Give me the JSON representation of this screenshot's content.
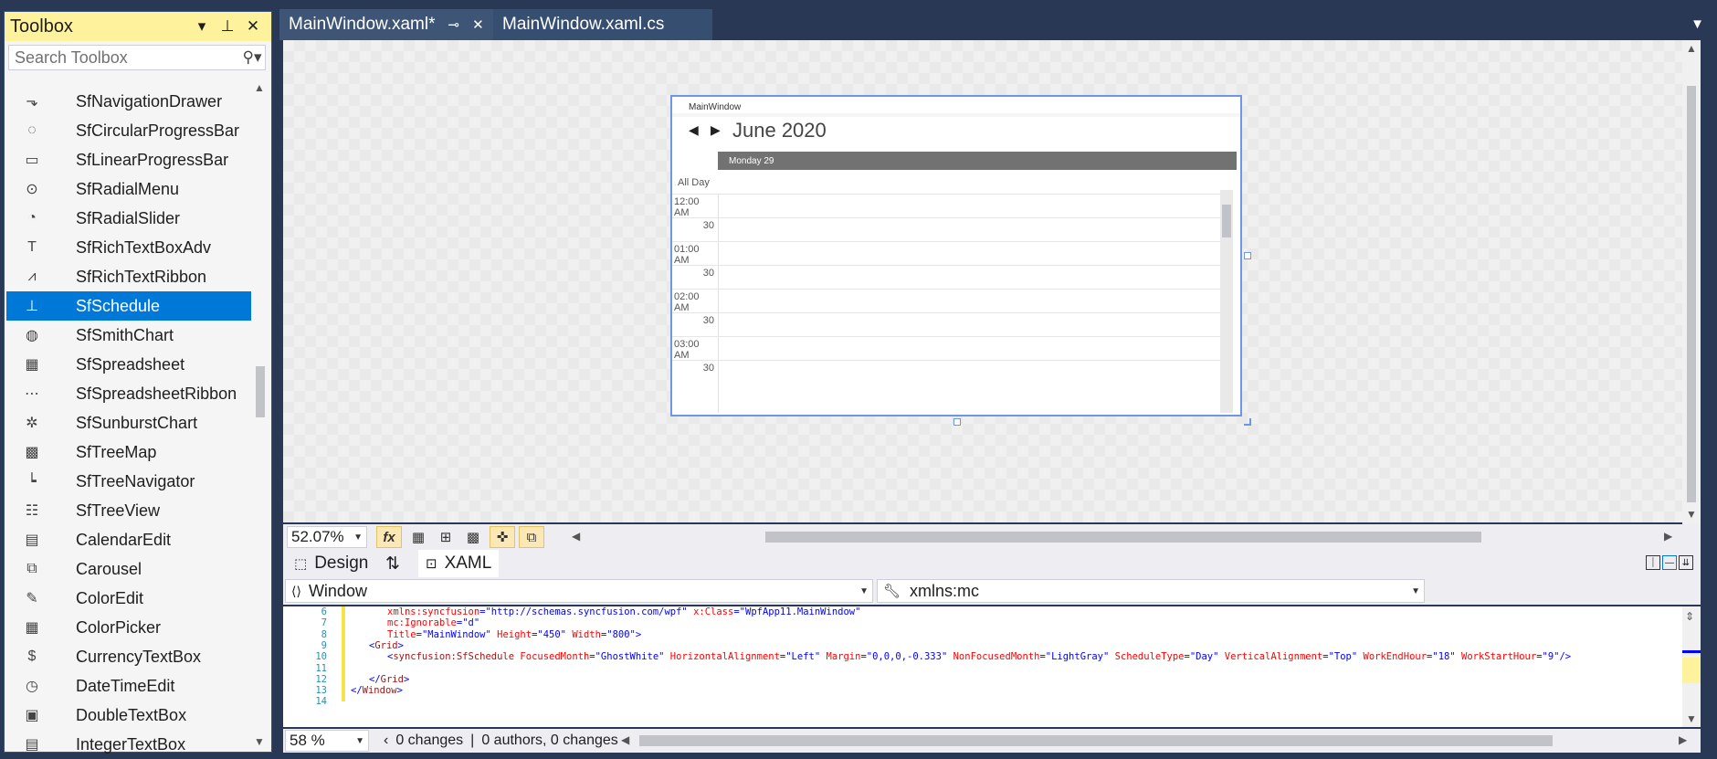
{
  "toolbox": {
    "title": "Toolbox",
    "search_placeholder": "Search Toolbox",
    "items": [
      {
        "label": "SfNavigationDrawer",
        "icon": "navigation-drawer-icon",
        "glyph": "⬎",
        "selected": false
      },
      {
        "label": "SfCircularProgressBar",
        "icon": "circular-progress-icon",
        "glyph": "◌",
        "selected": false
      },
      {
        "label": "SfLinearProgressBar",
        "icon": "linear-progress-icon",
        "glyph": "▭",
        "selected": false
      },
      {
        "label": "SfRadialMenu",
        "icon": "radial-menu-icon",
        "glyph": "⊙",
        "selected": false
      },
      {
        "label": "SfRadialSlider",
        "icon": "radial-slider-icon",
        "glyph": "◔",
        "selected": false
      },
      {
        "label": "SfRichTextBoxAdv",
        "icon": "rich-textbox-icon",
        "glyph": "T",
        "selected": false
      },
      {
        "label": "SfRichTextRibbon",
        "icon": "rich-text-ribbon-icon",
        "glyph": "⩘",
        "selected": false
      },
      {
        "label": "SfSchedule",
        "icon": "schedule-icon",
        "glyph": "⊥",
        "selected": true
      },
      {
        "label": "SfSmithChart",
        "icon": "smith-chart-icon",
        "glyph": "◍",
        "selected": false
      },
      {
        "label": "SfSpreadsheet",
        "icon": "spreadsheet-icon",
        "glyph": "▦",
        "selected": false
      },
      {
        "label": "SfSpreadsheetRibbon",
        "icon": "spreadsheet-ribbon-icon",
        "glyph": "⋯",
        "selected": false
      },
      {
        "label": "SfSunburstChart",
        "icon": "sunburst-chart-icon",
        "glyph": "✲",
        "selected": false
      },
      {
        "label": "SfTreeMap",
        "icon": "treemap-icon",
        "glyph": "▩",
        "selected": false
      },
      {
        "label": "SfTreeNavigator",
        "icon": "tree-navigator-icon",
        "glyph": "┕",
        "selected": false
      },
      {
        "label": "SfTreeView",
        "icon": "treeview-icon",
        "glyph": "☷",
        "selected": false
      },
      {
        "label": "CalendarEdit",
        "icon": "calendar-edit-icon",
        "glyph": "▤",
        "selected": false
      },
      {
        "label": "Carousel",
        "icon": "carousel-icon",
        "glyph": "⧉",
        "selected": false
      },
      {
        "label": "ColorEdit",
        "icon": "color-edit-icon",
        "glyph": "✎",
        "selected": false
      },
      {
        "label": "ColorPicker",
        "icon": "color-picker-icon",
        "glyph": "▦",
        "selected": false
      },
      {
        "label": "CurrencyTextBox",
        "icon": "currency-textbox-icon",
        "glyph": "$",
        "selected": false
      },
      {
        "label": "DateTimeEdit",
        "icon": "datetime-edit-icon",
        "glyph": "◷",
        "selected": false
      },
      {
        "label": "DoubleTextBox",
        "icon": "double-textbox-icon",
        "glyph": "▣",
        "selected": false
      },
      {
        "label": "IntegerTextBox",
        "icon": "integer-textbox-icon",
        "glyph": "▤",
        "selected": false
      }
    ]
  },
  "tabs": {
    "active": "MainWindow.xaml*",
    "inactive": "MainWindow.xaml.cs"
  },
  "preview": {
    "window_title": "MainWindow",
    "month": "June 2020",
    "day_header": "Monday 29",
    "all_day": "All Day",
    "time_slots": [
      {
        "hour": "12:00 AM",
        "half": "30"
      },
      {
        "hour": "01:00 AM",
        "half": "30"
      },
      {
        "hour": "02:00 AM",
        "half": "30"
      },
      {
        "hour": "03:00 AM",
        "half": "30"
      }
    ]
  },
  "designer_toolbar": {
    "zoom": "52.07%"
  },
  "split": {
    "design": "Design",
    "swap": "⇅",
    "xaml": "XAML"
  },
  "combos": {
    "element": "Window",
    "member": "xmlns:mc"
  },
  "code": {
    "lines": [
      {
        "num": "6",
        "html": "<span class=\"c-attr\">xmlns:syncfusion</span><span class=\"c-punc\">=</span><span class=\"c-val\">\"http://schemas.syncfusion.com/wpf\"</span> <span class=\"c-attr\">x:Class</span><span class=\"c-punc\">=</span><span class=\"c-val\">\"WpfApp11.MainWindow\"</span>",
        "indent": 2
      },
      {
        "num": "7",
        "html": "<span class=\"c-attr\">mc:Ignorable</span><span class=\"c-punc\">=</span><span class=\"c-val\">\"d\"</span>",
        "indent": 2
      },
      {
        "num": "8",
        "html": "<span class=\"c-attr\">Title</span><span class=\"c-punc\">=</span><span class=\"c-val\">\"MainWindow\"</span> <span class=\"c-attr\">Height</span><span class=\"c-punc\">=</span><span class=\"c-val\">\"450\"</span> <span class=\"c-attr\">Width</span><span class=\"c-punc\">=</span><span class=\"c-val\">\"800\"</span><span class=\"c-punc\">&gt;</span>",
        "indent": 2
      },
      {
        "num": "9",
        "html": "<span class=\"c-punc\">&lt;</span><span class=\"c-tag\">Grid</span><span class=\"c-punc\">&gt;</span>",
        "indent": 1
      },
      {
        "num": "10",
        "html": "<span class=\"c-punc\">&lt;</span><span class=\"c-tag\">syncfusion:SfSchedule</span> <span class=\"c-attr\">FocusedMonth</span><span class=\"c-punc\">=</span><span class=\"c-val\">\"GhostWhite\"</span> <span class=\"c-attr\">HorizontalAlignment</span><span class=\"c-punc\">=</span><span class=\"c-val\">\"Left\"</span> <span class=\"c-attr\">Margin</span><span class=\"c-punc\">=</span><span class=\"c-val\">\"0,0,0,-0.333\"</span> <span class=\"c-attr\">NonFocusedMonth</span><span class=\"c-punc\">=</span><span class=\"c-val\">\"LightGray\"</span> <span class=\"c-attr\">ScheduleType</span><span class=\"c-punc\">=</span><span class=\"c-val\">\"Day\"</span> <span class=\"c-attr\">VerticalAlignment</span><span class=\"c-punc\">=</span><span class=\"c-val\">\"Top\"</span> <span class=\"c-attr\">WorkEndHour</span><span class=\"c-punc\">=</span><span class=\"c-val\">\"18\"</span> <span class=\"c-attr\">WorkStartHour</span><span class=\"c-punc\">=</span><span class=\"c-val\">\"9\"</span><span class=\"c-punc\">/&gt;</span>",
        "indent": 2
      },
      {
        "num": "11",
        "html": "",
        "indent": 0
      },
      {
        "num": "12",
        "html": "<span class=\"c-punc\">&lt;/</span><span class=\"c-tag\">Grid</span><span class=\"c-punc\">&gt;</span>",
        "indent": 1
      },
      {
        "num": "13",
        "html": "<span class=\"c-punc\">&lt;/</span><span class=\"c-tag\">Window</span><span class=\"c-punc\">&gt;</span>",
        "indent": 0
      },
      {
        "num": "14",
        "html": "",
        "indent": 0
      }
    ]
  },
  "status": {
    "zoom": "58 %",
    "changes": "0 changes",
    "authors": "0 authors, 0 changes"
  },
  "colors": {
    "chrome": "#293955",
    "toolbox_header": "#fff29d",
    "selection": "#0078d7",
    "designer_selection": "#6f96e3"
  }
}
